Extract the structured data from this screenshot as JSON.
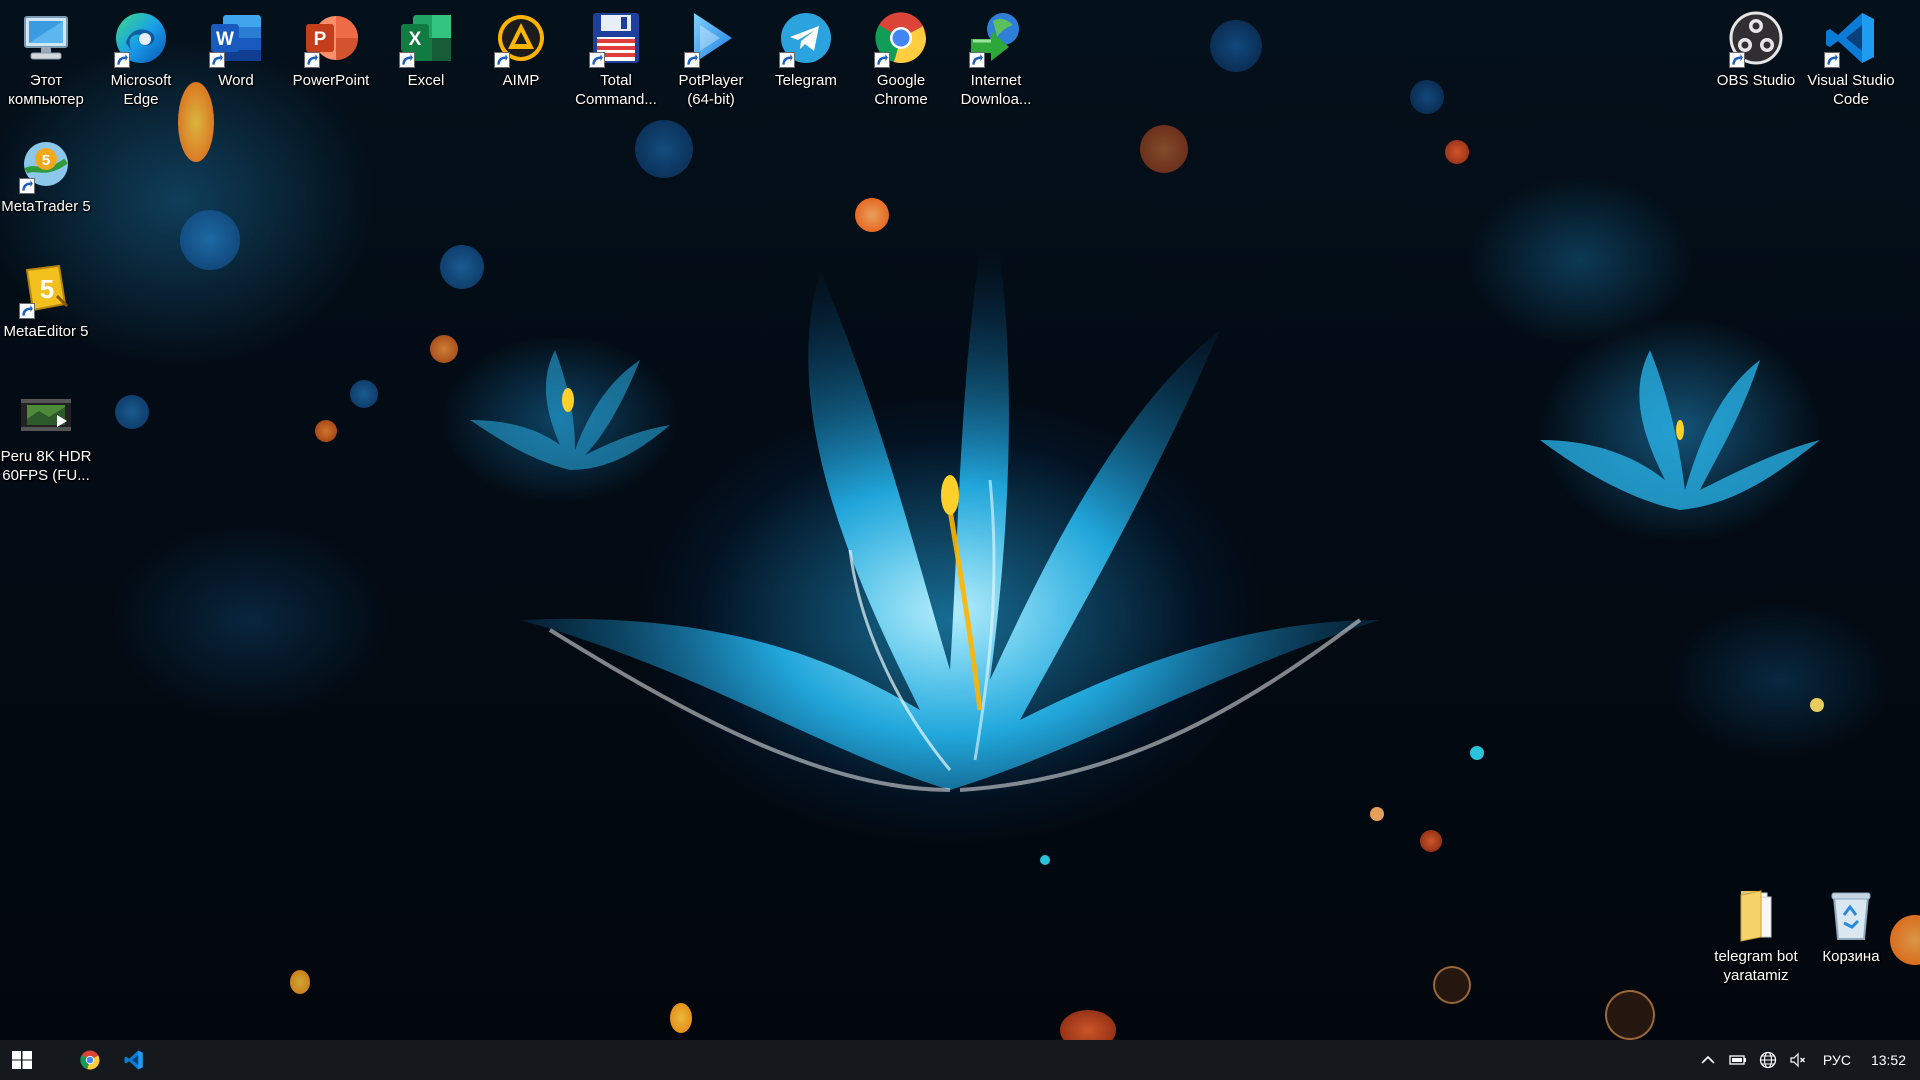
{
  "desktop": {
    "icons": [
      {
        "label": "Этот компьютер",
        "icon": "this-pc-icon",
        "shortcut": false
      },
      {
        "label": "Microsoft Edge",
        "icon": "edge-icon",
        "shortcut": true
      },
      {
        "label": "Word",
        "icon": "word-icon",
        "shortcut": true
      },
      {
        "label": "PowerPoint",
        "icon": "powerpoint-icon",
        "shortcut": true
      },
      {
        "label": "Excel",
        "icon": "excel-icon",
        "shortcut": true
      },
      {
        "label": "AIMP",
        "icon": "aimp-icon",
        "shortcut": true
      },
      {
        "label": "Total Command...",
        "icon": "total-commander-icon",
        "shortcut": true
      },
      {
        "label": "PotPlayer (64-bit)",
        "icon": "potplayer-icon",
        "shortcut": true
      },
      {
        "label": "Telegram",
        "icon": "telegram-icon",
        "shortcut": true
      },
      {
        "label": "Google Chrome",
        "icon": "chrome-icon",
        "shortcut": true
      },
      {
        "label": "Internet Downloa...",
        "icon": "internet-download-manager-icon",
        "shortcut": true
      },
      {
        "label": "OBS Studio",
        "icon": "obs-icon",
        "shortcut": true
      },
      {
        "label": "Visual Studio Code",
        "icon": "vscode-icon",
        "shortcut": true
      },
      {
        "label": "MetaTrader 5",
        "icon": "metatrader-icon",
        "shortcut": true
      },
      {
        "label": "MetaEditor 5",
        "icon": "metaeditor-icon",
        "shortcut": true
      },
      {
        "label": "Peru 8K HDR 60FPS (FU...",
        "icon": "video-file-icon",
        "shortcut": false
      },
      {
        "label": "telegram bot yaratamiz",
        "icon": "folder-icon",
        "shortcut": false
      },
      {
        "label": "Корзина",
        "icon": "recycle-bin-icon",
        "shortcut": false
      }
    ]
  },
  "taskbar": {
    "pinned": [
      {
        "name": "start-button",
        "icon": "windows-icon"
      },
      {
        "name": "taskbar-chrome",
        "icon": "chrome-icon"
      },
      {
        "name": "taskbar-vscode",
        "icon": "vscode-icon"
      }
    ],
    "tray": {
      "language": "РУС",
      "time": "13:52"
    }
  },
  "colors": {
    "taskbar": "#15191e",
    "vscode_blue": "#0a7bd6",
    "wallpaper_glow": "#28bef0"
  }
}
